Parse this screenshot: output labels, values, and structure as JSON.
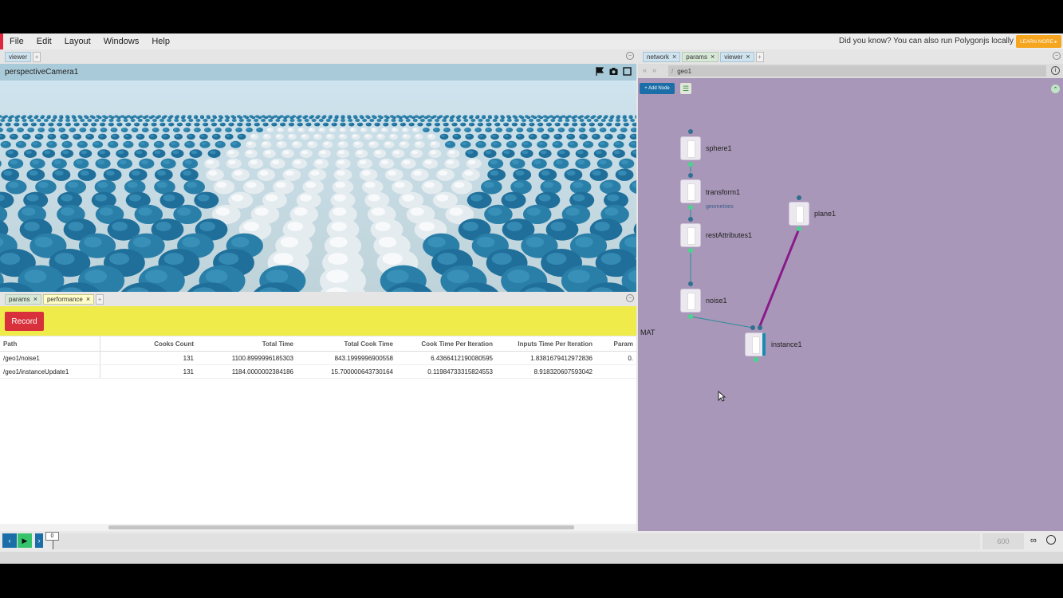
{
  "menu": {
    "items": [
      "File",
      "Edit",
      "Layout",
      "Windows",
      "Help"
    ],
    "tip": "Did you know? You can also run Polygonjs locally",
    "learn_more": "LEARN MORE ▸"
  },
  "left_panel": {
    "top_tabs": [
      "viewer"
    ],
    "camera_name": "perspectiveCamera1",
    "bottom_tabs": [
      {
        "label": "params",
        "closable": true
      },
      {
        "label": "performance",
        "closable": true
      }
    ],
    "record_label": "Record"
  },
  "perf_table": {
    "headers": [
      "Path",
      "Cooks Count",
      "Total Time",
      "Total Cook Time",
      "Cook Time Per Iteration",
      "Inputs Time Per Iteration",
      "Param"
    ],
    "rows": [
      [
        "/geo1/noise1",
        "131",
        "1100.8999996185303",
        "843.1999996900558",
        "6.4366412190080595",
        "1.8381679412972836",
        "0."
      ],
      [
        "/geo1/instanceUpdate1",
        "131",
        "1184.0000002384186",
        "15.700000643730164",
        "0.11984733315824553",
        "8.918320607593042",
        ""
      ]
    ]
  },
  "right_panel": {
    "tabs": [
      {
        "label": "network",
        "closable": true
      },
      {
        "label": "params",
        "closable": true
      },
      {
        "label": "viewer",
        "closable": true
      }
    ],
    "path": "geo1",
    "add_node_label": "+ Add Node",
    "mat_label": "MAT",
    "nodes": {
      "sphere": "sphere1",
      "transform": "transform1",
      "transform_sub": "geometries",
      "rest": "restAttributes1",
      "noise": "noise1",
      "plane": "plane1",
      "instance": "instance1"
    }
  },
  "timeline": {
    "current_frame": "0",
    "end_frame": "600"
  },
  "colors": {
    "accent": "#1b6ea7",
    "record": "#d8313b",
    "perf_bar": "#eeeb4a",
    "network_bg": "#a897b8",
    "learn_more": "#f6a51f"
  }
}
